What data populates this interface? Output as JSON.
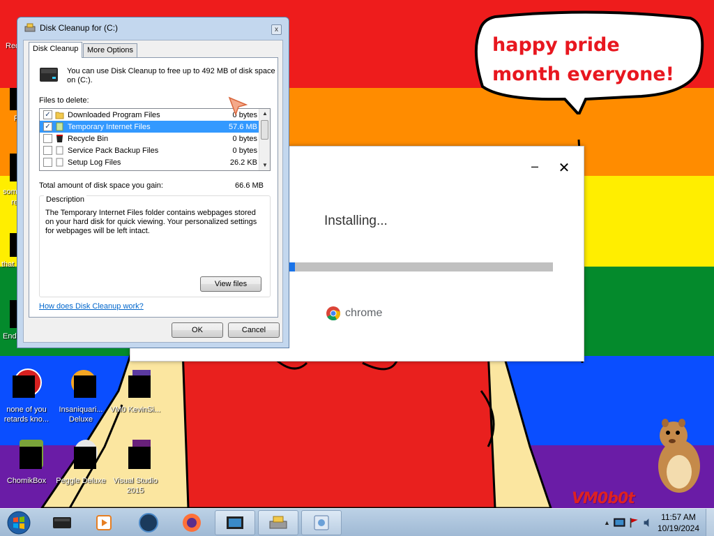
{
  "desktop": {
    "speech_bubble_text": "happy pride month everyone!",
    "watermark": "VM0b0t",
    "icons": [
      {
        "label": "none of you retards kno..."
      },
      {
        "label": "Insaniquari... Deluxe"
      },
      {
        "label": "VM0 KevinSi..."
      },
      {
        "label": "ChomikBox"
      },
      {
        "label": "Peggle Deluxe"
      },
      {
        "label": "Visual Studio 2015"
      }
    ],
    "edge_labels": [
      "Rec",
      "F",
      "som",
      "re",
      "that",
      "End"
    ]
  },
  "installer": {
    "status": "Installing...",
    "progress_fraction": 0.02,
    "brand": "chrome"
  },
  "disk_cleanup": {
    "title": "Disk Cleanup for  (C:)",
    "tabs": [
      {
        "label": "Disk Cleanup",
        "active": true
      },
      {
        "label": "More Options",
        "active": false
      }
    ],
    "intro": "You can use Disk Cleanup to free up to 492 MB of disk space on  (C:).",
    "files_label": "Files to delete:",
    "files": [
      {
        "name": "Downloaded Program Files",
        "size": "0 bytes",
        "checked": true,
        "selected": false
      },
      {
        "name": "Temporary Internet Files",
        "size": "57.6 MB",
        "checked": true,
        "selected": true
      },
      {
        "name": "Recycle Bin",
        "size": "0 bytes",
        "checked": false,
        "selected": false
      },
      {
        "name": "Service Pack Backup Files",
        "size": "0 bytes",
        "checked": false,
        "selected": false
      },
      {
        "name": "Setup Log Files",
        "size": "26.2 KB",
        "checked": false,
        "selected": false
      }
    ],
    "total_label": "Total amount of disk space you gain:",
    "total_value": "66.6 MB",
    "description_legend": "Description",
    "description": "The Temporary Internet Files folder contains webpages stored on your hard disk for quick viewing. Your personalized settings for webpages will be left intact.",
    "view_files": "View files",
    "help_link": "How does Disk Cleanup work?",
    "ok": "OK",
    "cancel": "Cancel",
    "close_glyph": "x"
  },
  "taskbar": {
    "time": "11:57 AM",
    "date": "10/19/2024"
  },
  "colors": {
    "red": "#ee1c1c",
    "orange": "#ff8c00",
    "yellow": "#ffee00",
    "green": "#048a2c",
    "blue": "#0a4eff",
    "purple": "#6a1ca6",
    "selection": "#3399ff",
    "link": "#0066cc"
  }
}
